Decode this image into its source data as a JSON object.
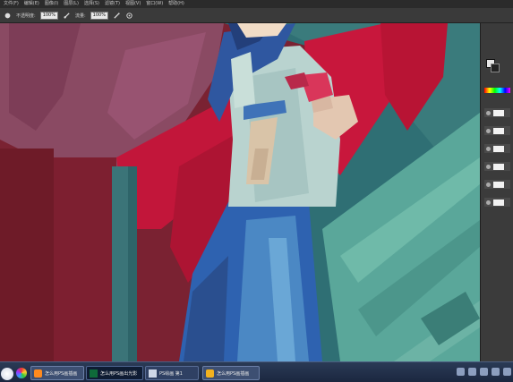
{
  "menubar": {
    "items": [
      "文件(F)",
      "编辑(E)",
      "图像(I)",
      "图层(L)",
      "选择(S)",
      "滤镜(T)",
      "视图(V)",
      "窗口(W)",
      "帮助(H)"
    ]
  },
  "options": {
    "mode_label": "不透明度:",
    "opacity_value": "100%",
    "flow_label": "流量:",
    "flow_value": "100%",
    "icons": [
      "brush-preset-icon",
      "pressure-opacity-icon",
      "airbrush-icon",
      "pressure-size-icon"
    ]
  },
  "panel": {
    "layer_count": 6,
    "colors": {
      "foreground": "#e6e6e6",
      "background": "#222222"
    }
  },
  "taskbar": {
    "tasks": [
      {
        "label": "怎么用PS画插画"
      },
      {
        "label": "怎么用PS画出光影"
      },
      {
        "label": "PS绘画 第1"
      },
      {
        "label": "怎么用PS画插画"
      }
    ]
  },
  "colors": {
    "canvas_red": "#c2163a",
    "canvas_teal": "#5aa79a",
    "skirt_blue": "#2e62b0",
    "shirt": "#b9d3cf",
    "menubar": "#2b2b2b",
    "taskbar": "#1b2740"
  }
}
